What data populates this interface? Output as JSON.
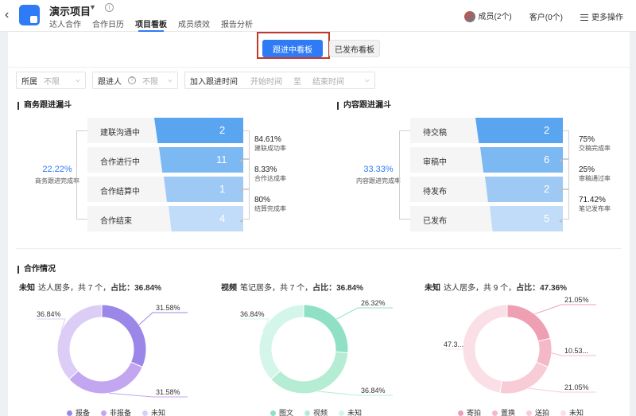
{
  "header": {
    "project_title": "演示项目",
    "tabs": [
      "达人合作",
      "合作日历",
      "项目看板",
      "成员绩效",
      "报告分析"
    ],
    "members": "成员(2个)",
    "customers": "客户(0个)",
    "more": "更多操作"
  },
  "view_toggle": {
    "active": "跟进中看板",
    "other": "已发布看板"
  },
  "filters": {
    "owner_label": "所属",
    "owner_value": "不限",
    "follower_label": "跟进人",
    "follower_value": "不限",
    "join_time_label": "加入跟进时间",
    "start_ph": "开始时间",
    "to": "至",
    "end_ph": "结束时间"
  },
  "business_funnel": {
    "title": "商务跟进漏斗",
    "overall_pct": "22.22%",
    "overall_caption": "商务跟进完成率",
    "stages": [
      {
        "label": "建联沟通中",
        "value": "2"
      },
      {
        "label": "合作进行中",
        "value": "11"
      },
      {
        "label": "合作结算中",
        "value": "1"
      },
      {
        "label": "合作结束",
        "value": "4"
      }
    ],
    "rates": [
      {
        "pct": "84.61%",
        "caption": "建联成功率"
      },
      {
        "pct": "8.33%",
        "caption": "合作达成率"
      },
      {
        "pct": "80%",
        "caption": "结算完成率"
      }
    ]
  },
  "content_funnel": {
    "title": "内容跟进漏斗",
    "overall_pct": "33.33%",
    "overall_caption": "内容跟进完成率",
    "stages": [
      {
        "label": "待交稿",
        "value": "2"
      },
      {
        "label": "审稿中",
        "value": "6"
      },
      {
        "label": "待发布",
        "value": "2"
      },
      {
        "label": "已发布",
        "value": "5"
      }
    ],
    "rates": [
      {
        "pct": "75%",
        "caption": "交稿完成率"
      },
      {
        "pct": "25%",
        "caption": "审稿通过率"
      },
      {
        "pct": "71.42%",
        "caption": "笔记发布率"
      }
    ]
  },
  "cooperation": {
    "title": "合作情况",
    "charts": [
      {
        "lead": "未知",
        "desc": "达人居多，共 7 个，",
        "stat": "占比：36.84%",
        "slices": [
          {
            "name": "报备",
            "pct": 31.58,
            "label": "31.58%",
            "color": "#9b87e8"
          },
          {
            "name": "非报备",
            "pct": 31.58,
            "label": "31.58%",
            "color": "#c3a6f0"
          },
          {
            "name": "未知",
            "pct": 36.84,
            "label": "36.84%",
            "color": "#dccdf6"
          }
        ]
      },
      {
        "lead": "视频",
        "desc": "笔记居多，共 7 个，",
        "stat": "占比：36.84%",
        "slices": [
          {
            "name": "图文",
            "pct": 26.32,
            "label": "26.32%",
            "color": "#8fe0c4"
          },
          {
            "name": "视频",
            "pct": 36.84,
            "label": "36.84%",
            "color": "#b5ecd4"
          },
          {
            "name": "未知",
            "pct": 36.84,
            "label": "36.84%",
            "color": "#d4f6ea"
          }
        ]
      },
      {
        "lead": "未知",
        "desc": "达人居多，共 9 个，",
        "stat": "占比：47.36%",
        "slices": [
          {
            "name": "寄拍",
            "pct": 21.05,
            "label": "21.05%",
            "color": "#ef9fb4"
          },
          {
            "name": "置换",
            "pct": 10.53,
            "label": "10.53...",
            "color": "#f4b8c6"
          },
          {
            "name": "送拍",
            "pct": 21.05,
            "label": "21.05%",
            "color": "#f7ccd6"
          },
          {
            "name": "未知",
            "pct": 47.36,
            "label": "47.3...",
            "color": "#fae0e6"
          }
        ]
      }
    ]
  }
}
